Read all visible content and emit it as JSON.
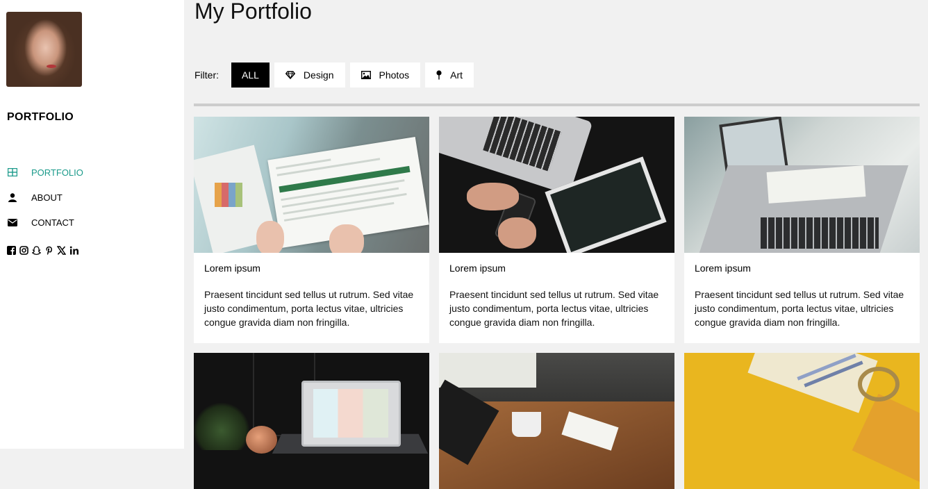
{
  "sidebar": {
    "brand": "PORTFOLIO",
    "nav": [
      {
        "label": "PORTFOLIO",
        "icon": "grid-icon",
        "active": true
      },
      {
        "label": "ABOUT",
        "icon": "user-icon",
        "active": false
      },
      {
        "label": "CONTACT",
        "icon": "envelope-icon",
        "active": false
      }
    ],
    "social": [
      "facebook-icon",
      "instagram-icon",
      "snapchat-icon",
      "pinterest-icon",
      "x-icon",
      "linkedin-icon"
    ]
  },
  "main": {
    "title": "My Portfolio",
    "filter": {
      "label": "Filter:",
      "options": [
        {
          "label": "ALL",
          "icon": "",
          "active": true
        },
        {
          "label": "Design",
          "icon": "diamond-icon",
          "active": false
        },
        {
          "label": "Photos",
          "icon": "image-icon",
          "active": false
        },
        {
          "label": "Art",
          "icon": "map-pin-icon",
          "active": false
        }
      ]
    },
    "cards": [
      {
        "title": "Lorem ipsum",
        "desc": "Praesent tincidunt sed tellus ut rutrum. Sed vitae justo condimentum, porta lectus vitae, ultricies congue gravida diam non fringilla."
      },
      {
        "title": "Lorem ipsum",
        "desc": "Praesent tincidunt sed tellus ut rutrum. Sed vitae justo condimentum, porta lectus vitae, ultricies congue gravida diam non fringilla."
      },
      {
        "title": "Lorem ipsum",
        "desc": "Praesent tincidunt sed tellus ut rutrum. Sed vitae justo condimentum, porta lectus vitae, ultricies congue gravida diam non fringilla."
      },
      {
        "title": "",
        "desc": ""
      },
      {
        "title": "",
        "desc": ""
      },
      {
        "title": "",
        "desc": ""
      }
    ]
  },
  "colors": {
    "accent": "#1a9a8a",
    "background": "#f1f1f1",
    "active_filter_bg": "#000000"
  }
}
